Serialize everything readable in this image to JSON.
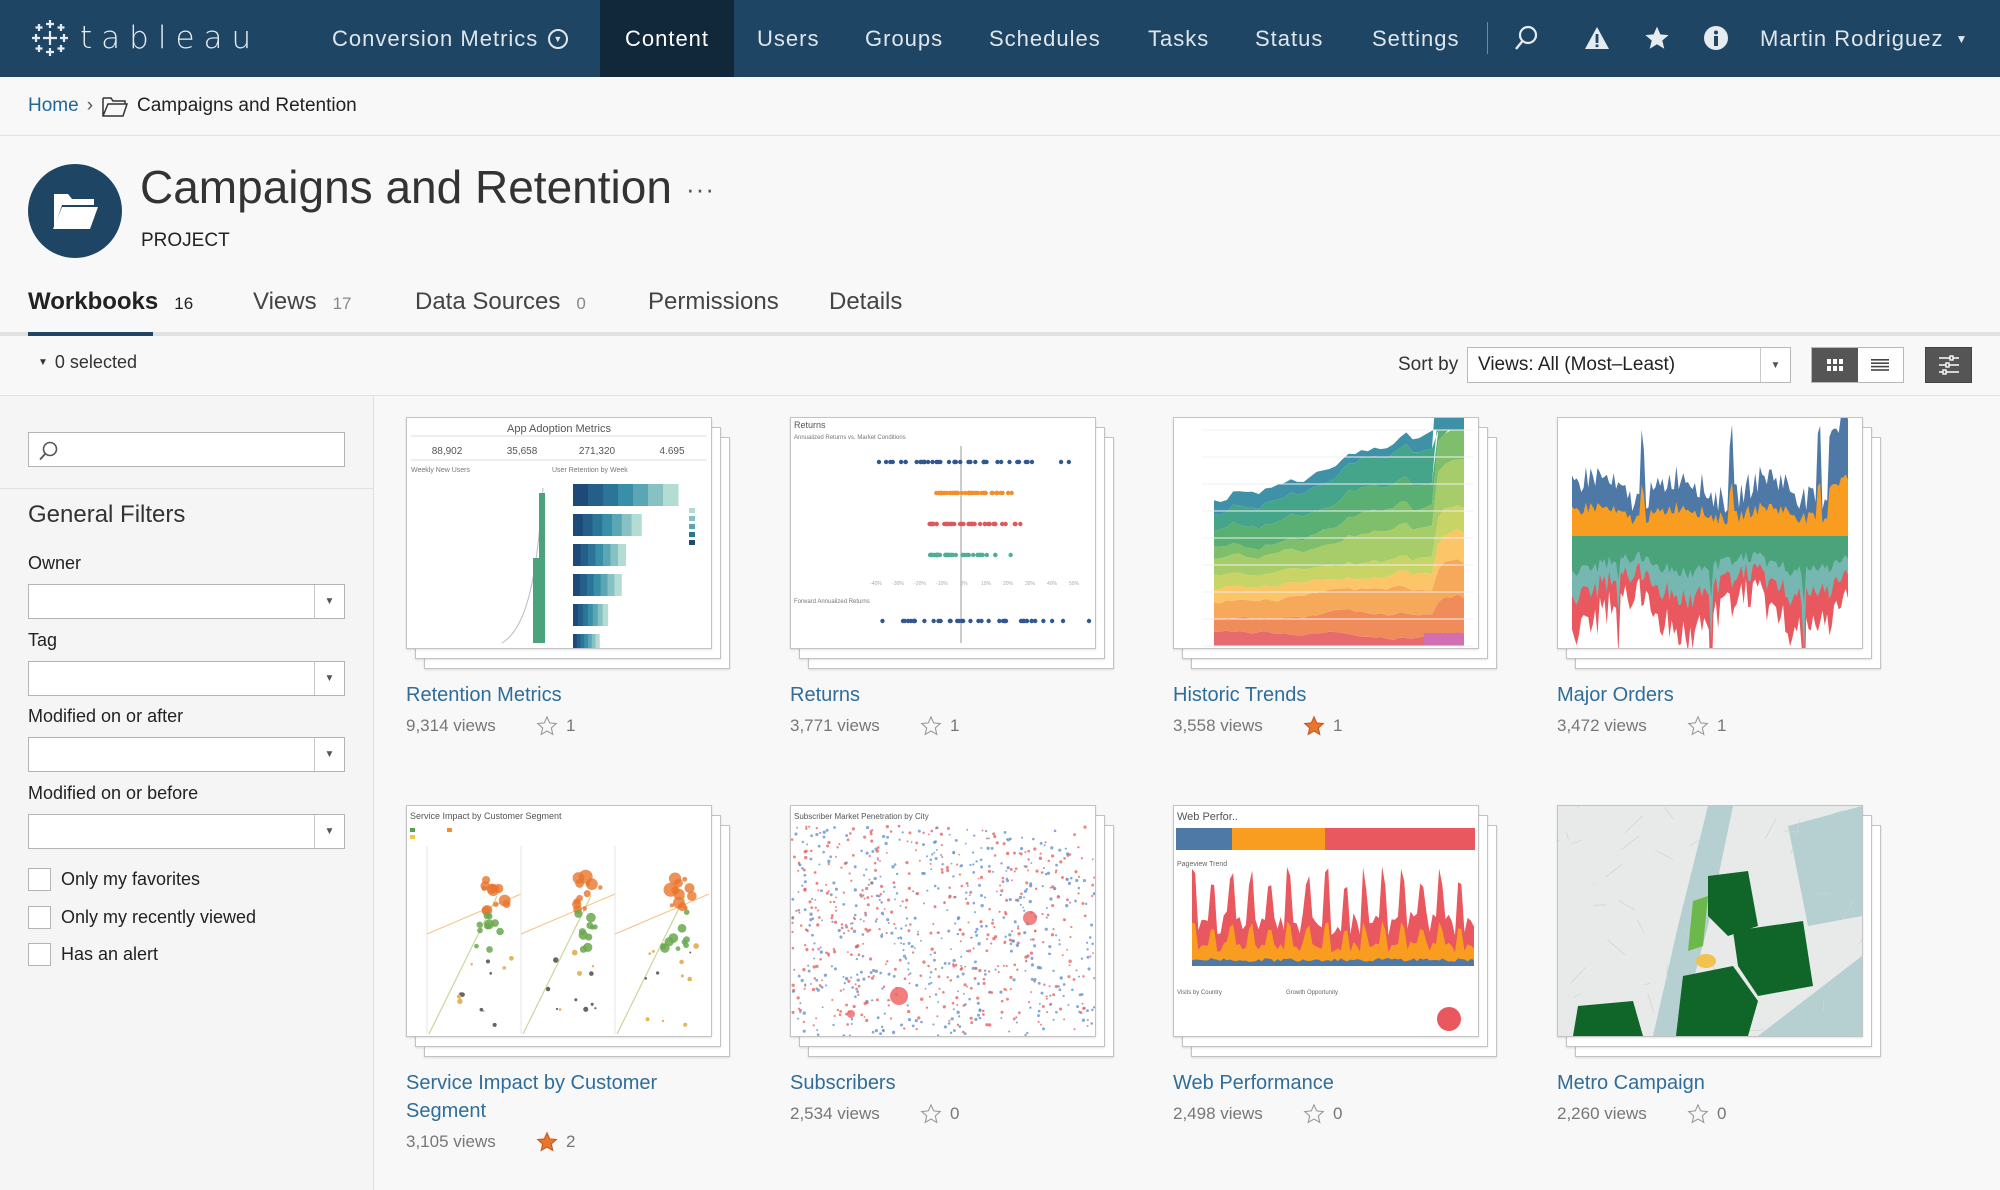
{
  "nav": {
    "brand": "tableau",
    "site": "Conversion Metrics",
    "items": [
      {
        "label": "Content",
        "active": true
      },
      {
        "label": "Users"
      },
      {
        "label": "Groups"
      },
      {
        "label": "Schedules"
      },
      {
        "label": "Tasks"
      },
      {
        "label": "Status"
      },
      {
        "label": "Settings"
      }
    ],
    "icons": [
      "search-icon",
      "alert-icon",
      "favorites-star-icon",
      "info-icon"
    ],
    "user": "Martin Rodriguez"
  },
  "breadcrumb": {
    "home": "Home",
    "current": "Campaigns and Retention"
  },
  "project": {
    "title": "Campaigns and Retention",
    "more": "···",
    "type": "PROJECT"
  },
  "tabs": [
    {
      "label": "Workbooks",
      "count": "16",
      "active": true
    },
    {
      "label": "Views",
      "count": "17"
    },
    {
      "label": "Data Sources",
      "count": "0"
    },
    {
      "label": "Permissions",
      "count": ""
    },
    {
      "label": "Details",
      "count": ""
    }
  ],
  "toolbar": {
    "selected": "0 selected",
    "sort_label": "Sort by",
    "sort_value": "Views: All (Most–Least)",
    "view_mode": "grid"
  },
  "sidebar": {
    "search_placeholder": "",
    "filters_title": "General Filters",
    "filters": [
      {
        "label": "Owner",
        "value": ""
      },
      {
        "label": "Tag",
        "value": ""
      },
      {
        "label": "Modified on or after",
        "value": ""
      },
      {
        "label": "Modified on or before",
        "value": ""
      }
    ],
    "checkboxes": [
      {
        "label": "Only my favorites",
        "checked": false
      },
      {
        "label": "Only my recently viewed",
        "checked": false
      },
      {
        "label": "Has an alert",
        "checked": false
      }
    ]
  },
  "workbooks": [
    {
      "title": "Retention Metrics",
      "views": "9,314 views",
      "favorites": "1",
      "favorited": false,
      "thumb": "app-adoption",
      "thumb_title": "App Adoption Metrics",
      "kpis": [
        "88,902",
        "35,658",
        "271,320",
        "4.695"
      ]
    },
    {
      "title": "Returns",
      "views": "3,771 views",
      "favorites": "1",
      "favorited": false,
      "thumb": "returns",
      "thumb_title": "Returns"
    },
    {
      "title": "Historic Trends",
      "views": "3,558 views",
      "favorites": "1",
      "favorited": true,
      "thumb": "stacked-area"
    },
    {
      "title": "Major Orders",
      "views": "3,472 views",
      "favorites": "1",
      "favorited": false,
      "thumb": "diverging-area"
    },
    {
      "title": "Service Impact by Customer Segment",
      "views": "3,105 views",
      "favorites": "2",
      "favorited": true,
      "thumb": "scatter-panels",
      "thumb_title": "Service Impact by Customer Segment"
    },
    {
      "title": "Subscribers",
      "views": "2,534 views",
      "favorites": "0",
      "favorited": false,
      "thumb": "dot-map",
      "thumb_title": "Subscriber Market Penetration by City"
    },
    {
      "title": "Web Performance",
      "views": "2,498 views",
      "favorites": "0",
      "favorited": false,
      "thumb": "web-perf",
      "thumb_title": "Web Perfor..",
      "thumb_subtitle": "Pageview Trend"
    },
    {
      "title": "Metro Campaign",
      "views": "2,260 views",
      "favorites": "0",
      "favorited": false,
      "thumb": "choropleth"
    }
  ],
  "colors": {
    "nav_bg": "#1f4564",
    "nav_active": "#11273a",
    "link": "#2f6d9a",
    "favorite": "#e8762d"
  }
}
